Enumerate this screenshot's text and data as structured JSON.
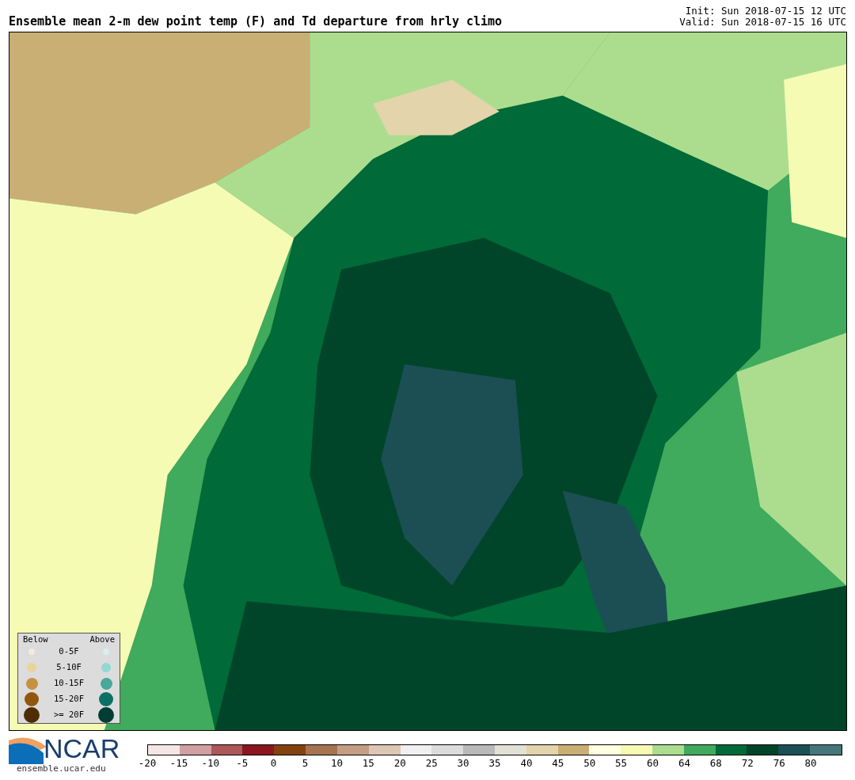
{
  "title": "Ensemble mean 2-m dew point temp (F) and Td departure from hrly climo",
  "init": "Init: Sun 2018-07-15 12 UTC",
  "valid": "Valid: Sun 2018-07-15 16 UTC",
  "legend": {
    "below_heading": "Below",
    "above_heading": "Above",
    "rows": [
      {
        "label": "0-5F",
        "below": {
          "color": "#f3ecdc"
        },
        "above": {
          "color": "#d6eeee"
        }
      },
      {
        "label": "5-10F",
        "below": {
          "color": "#ead39a"
        },
        "above": {
          "color": "#93d8d2"
        }
      },
      {
        "label": "10-15F",
        "below": {
          "color": "#c69140"
        },
        "above": {
          "color": "#47a89c"
        }
      },
      {
        "label": "15-20F",
        "below": {
          "color": "#93560f"
        },
        "above": {
          "color": "#0d7066"
        }
      },
      {
        "label": ">= 20F",
        "below": {
          "color": "#4e2d04"
        },
        "above": {
          "color": "#013d32"
        }
      }
    ]
  },
  "logo": {
    "name": "NCAR",
    "url": "ensemble.ucar.edu"
  },
  "colorbar": [
    {
      "color": "#f5e6e6",
      "label": "-20"
    },
    {
      "color": "#d0a0a2",
      "label": "-15"
    },
    {
      "color": "#ac5759",
      "label": "-10"
    },
    {
      "color": "#8b1620",
      "label": "-5"
    },
    {
      "color": "#84420f",
      "label": "0"
    },
    {
      "color": "#a77450",
      "label": "5"
    },
    {
      "color": "#c49e84",
      "label": "10"
    },
    {
      "color": "#dec6b4",
      "label": "15"
    },
    {
      "color": "#f0f0f0",
      "label": "20"
    },
    {
      "color": "#dcdcdc",
      "label": "25"
    },
    {
      "color": "#b9b9b9",
      "label": "30"
    },
    {
      "color": "#e2e2d4",
      "label": "35"
    },
    {
      "color": "#e3d4ab",
      "label": "40"
    },
    {
      "color": "#c9af74",
      "label": "45"
    },
    {
      "color": "#fefee0",
      "label": "50"
    },
    {
      "color": "#f6fbb3",
      "label": "55"
    },
    {
      "color": "#acdd8f",
      "label": "60"
    },
    {
      "color": "#40aa5d",
      "label": "64"
    },
    {
      "color": "#006a38",
      "label": "68"
    },
    {
      "color": "#00452a",
      "label": "72"
    },
    {
      "color": "#1b4f54",
      "label": "76"
    },
    {
      "color": "#46767a",
      "label": "80"
    }
  ]
}
